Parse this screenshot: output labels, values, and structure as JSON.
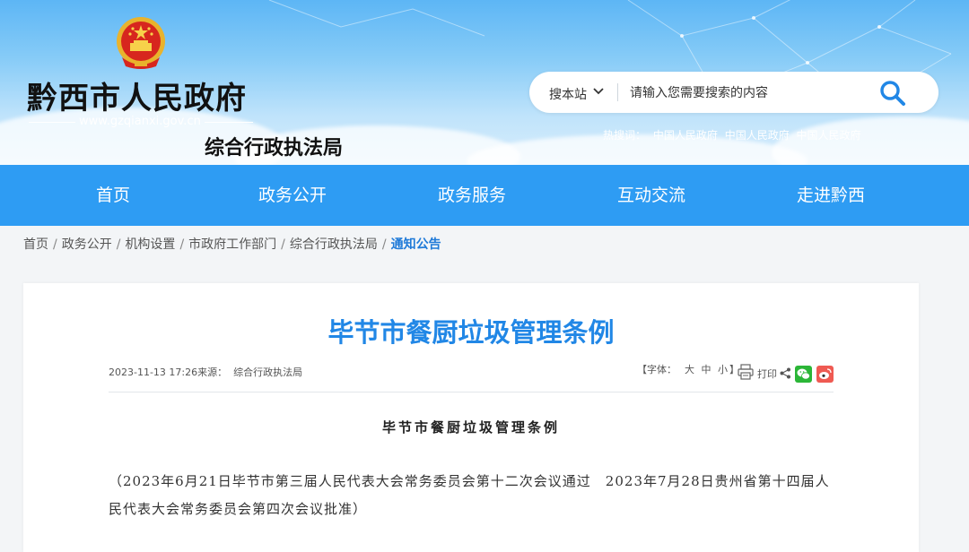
{
  "header": {
    "site_title": "黔西市人民政府",
    "site_url": "www.gzqianxi.gov.cn",
    "department": "综合行政执法局",
    "search": {
      "scope_label": "搜本站",
      "placeholder": "请输入您需要搜索的内容"
    },
    "hot_search": {
      "label": "热搜词：",
      "terms": [
        "中国人民政府",
        "中国人民政府",
        "中国人民政府"
      ]
    }
  },
  "nav": {
    "items": [
      "首页",
      "政务公开",
      "政务服务",
      "互动交流",
      "走进黔西"
    ]
  },
  "breadcrumb": {
    "items": [
      "首页",
      "政务公开",
      "机构设置",
      "市政府工作部门",
      "综合行政执法局"
    ],
    "current": "通知公告",
    "separator": "/"
  },
  "article": {
    "title": "毕节市餐厨垃圾管理条例",
    "datetime": "2023-11-13 17:26",
    "source_label": "来源：",
    "source": "综合行政执法局",
    "font_label_open": "【字体：",
    "font_sizes": [
      "大",
      "中",
      "小"
    ],
    "font_label_close": "】",
    "print_label": "打印",
    "body_title": "毕节市餐厨垃圾管理条例",
    "intro": "（2023年6月21日毕节市第三届人民代表大会常务委员会第十二次会议通过　2023年7月28日贵州省第十四届人民代表大会常务委员会第四次会议批准）"
  },
  "colors": {
    "nav_bg": "#2e9cf3",
    "title_blue": "#2187e6",
    "crumb_current": "#1f7ad8",
    "wechat": "#2bb637",
    "weibo": "#ef5a52"
  },
  "icons": [
    "national-emblem-icon",
    "chevron-down-icon",
    "search-icon",
    "printer-icon",
    "share-icon",
    "wechat-icon",
    "weibo-icon"
  ]
}
